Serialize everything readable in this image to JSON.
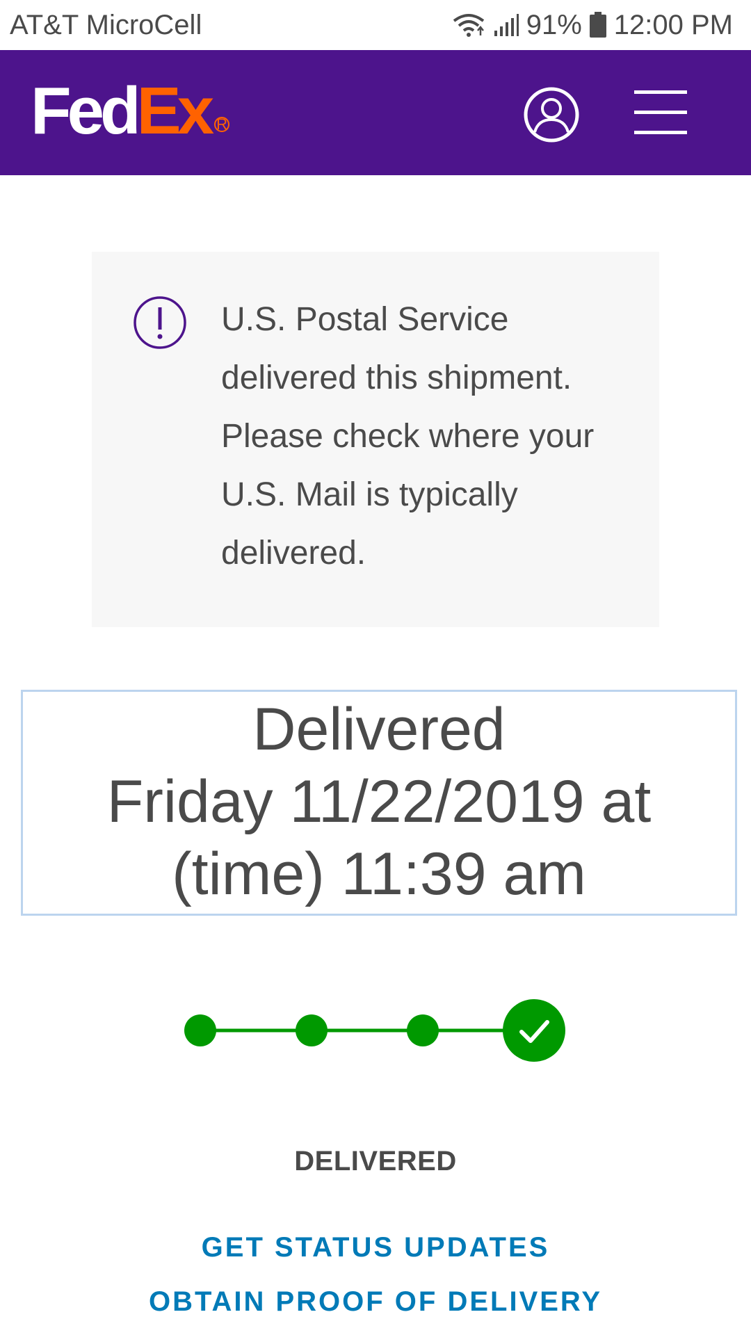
{
  "status_bar": {
    "carrier": "AT&T MicroCell",
    "battery": "91%",
    "time": "12:00 PM"
  },
  "header": {
    "logo_fed": "Fed",
    "logo_ex": "Ex",
    "logo_reg": "R",
    "account_icon": "user-circle-icon",
    "menu_icon": "hamburger-menu-icon"
  },
  "notice": {
    "icon": "exclamation-circle-icon",
    "lines": [
      "U.S. Postal Service",
      "delivered this shipment.",
      "Please check where your",
      "U.S. Mail is typically",
      "delivered."
    ]
  },
  "delivery": {
    "line1": "Delivered",
    "line2": "Friday 11/22/2019 at",
    "line3": "(time) 11:39 am"
  },
  "tracker": {
    "steps_total": 4,
    "steps_complete": 4,
    "final_icon": "checkmark-icon",
    "color": "#009900"
  },
  "status_label": "DELIVERED",
  "links": {
    "status_updates": "GET STATUS UPDATES",
    "proof_of_delivery": "OBTAIN PROOF OF DELIVERY"
  },
  "colors": {
    "brand_purple": "#4d148c",
    "brand_orange": "#ff6200",
    "link_blue": "#007ab7",
    "success_green": "#009900"
  }
}
